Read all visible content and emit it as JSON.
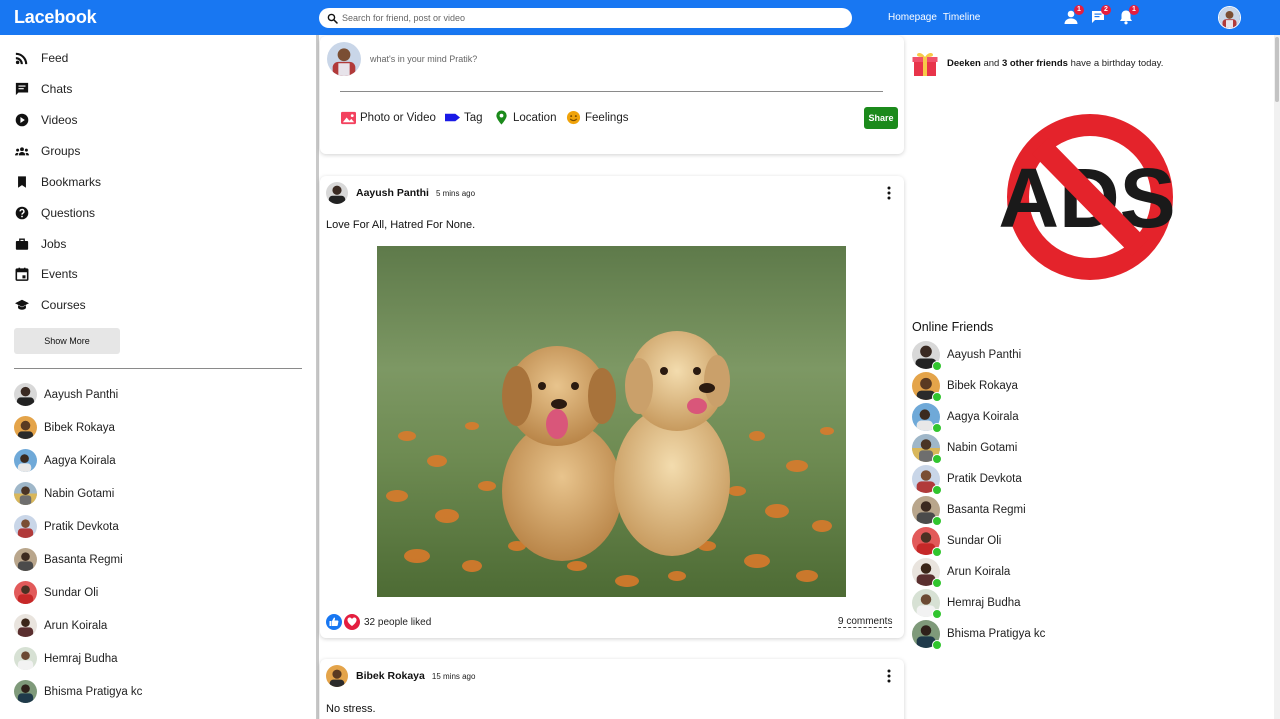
{
  "app": {
    "logo": "Lacebook"
  },
  "search": {
    "placeholder": "Search for friend, post or video"
  },
  "topbar": {
    "links": [
      "Homepage",
      "Timeline"
    ],
    "badges": {
      "friend_requests": "1",
      "messages": "2",
      "notifications": "1"
    }
  },
  "sidebar": {
    "items": [
      {
        "label": "Feed",
        "icon": "rss-icon"
      },
      {
        "label": "Chats",
        "icon": "chat-icon"
      },
      {
        "label": "Videos",
        "icon": "play-circle-icon"
      },
      {
        "label": "Groups",
        "icon": "groups-icon"
      },
      {
        "label": "Bookmarks",
        "icon": "bookmark-icon"
      },
      {
        "label": "Questions",
        "icon": "help-icon"
      },
      {
        "label": "Jobs",
        "icon": "briefcase-icon"
      },
      {
        "label": "Events",
        "icon": "calendar-icon"
      },
      {
        "label": "Courses",
        "icon": "graduation-cap-icon"
      }
    ],
    "show_more": "Show More",
    "friends": [
      "Aayush Panthi",
      "Bibek Rokaya",
      "Aagya Koirala",
      "Nabin Gotami",
      "Pratik Devkota",
      "Basanta Regmi",
      "Sundar Oli",
      "Arun Koirala",
      "Hemraj Budha",
      "Bhisma Pratigya kc"
    ]
  },
  "share": {
    "placeholder": "what's in your mind Pratik?",
    "options": [
      {
        "label": "Photo or Video",
        "icon": "photo-icon",
        "color": "#f3425f"
      },
      {
        "label": "Tag",
        "icon": "tag-icon",
        "color": "#1a1ae6"
      },
      {
        "label": "Location",
        "icon": "location-pin-icon",
        "color": "#1b8a1b"
      },
      {
        "label": "Feelings",
        "icon": "emoji-icon",
        "color": "#f0a30a"
      }
    ],
    "button": "Share"
  },
  "posts": [
    {
      "author": "Aayush Panthi",
      "time": "5 mins ago",
      "text": "Love For All, Hatred For None.",
      "likes": "32 people liked",
      "comments": "9 comments",
      "image": "two-puppies-in-flower-field"
    },
    {
      "author": "Bibek Rokaya",
      "time": "15 mins ago",
      "text": "No stress."
    }
  ],
  "birthday": {
    "name": "Deeken",
    "and": "and",
    "others": "3 other friends",
    "rest": "have a birthday today."
  },
  "ads": {
    "label": "ADS",
    "icon": "no-ads-icon"
  },
  "online": {
    "title": "Online Friends",
    "friends": [
      "Aayush Panthi",
      "Bibek Rokaya",
      "Aagya Koirala",
      "Nabin Gotami",
      "Pratik Devkota",
      "Basanta Regmi",
      "Sundar Oli",
      "Arun Koirala",
      "Hemraj Budha",
      "Bhisma Pratigya kc"
    ]
  },
  "colors": {
    "brand": "#1877f2",
    "share_button": "#1b8a1b",
    "online_dot": "#31c52e",
    "badge": "#e41e3f"
  }
}
